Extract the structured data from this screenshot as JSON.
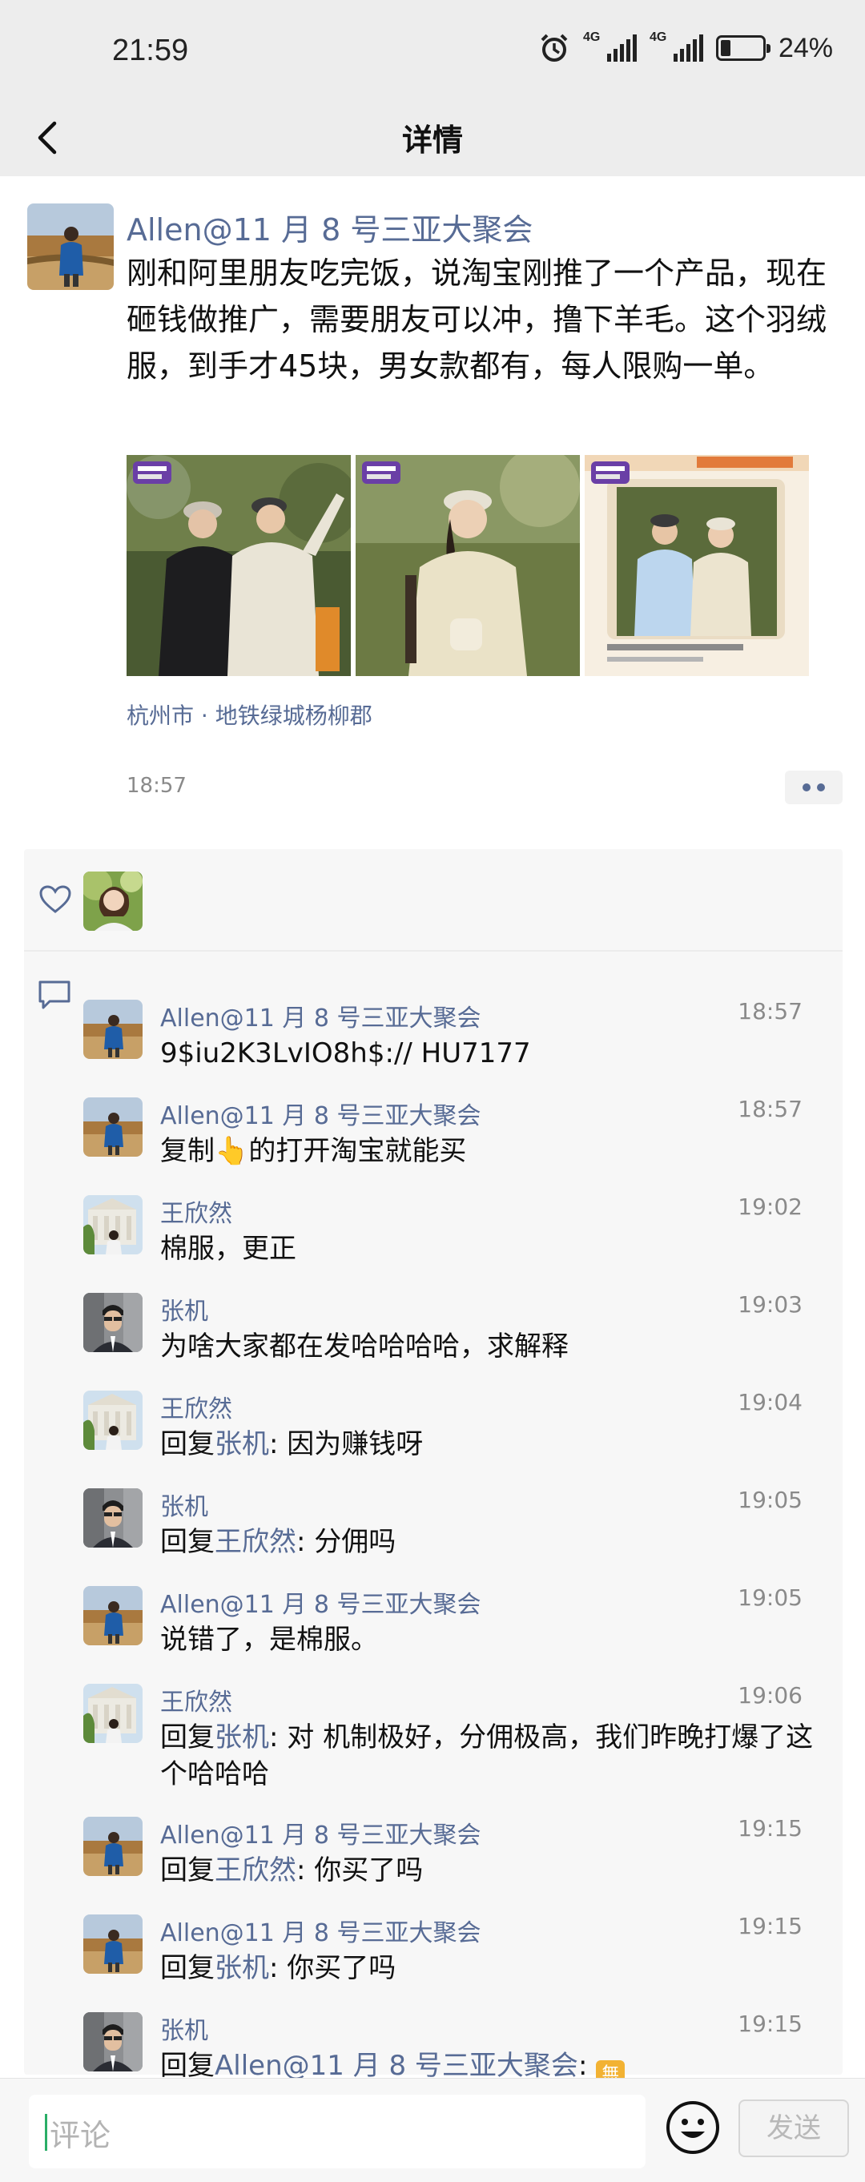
{
  "status_bar": {
    "time": "21:59",
    "net1": "4G",
    "net2": "4G",
    "battery": "24%",
    "battery_level": 0.24
  },
  "header": {
    "title": "详情",
    "back_icon": "chevron-left-icon"
  },
  "post": {
    "author": "Allen@11 月 8 号三亚大聚会",
    "text": "刚和阿里朋友吃完饭，说淘宝刚推了一个产品，现在砸钱做推广，需要朋友可以冲，撸下羊毛。这个羽绒服，到手才45块，男女款都有，每人限购一单。",
    "location": "杭州市 · 地铁绿城杨柳郡",
    "time": "18:57"
  },
  "colors": {
    "link": "#576b95",
    "accent_green": "#2aae67"
  },
  "comments": [
    {
      "author": "Allen@11 月 8 号三亚大聚会",
      "time": "18:57",
      "reply_prefix": "",
      "reply_to": "",
      "text": "9$iu2K3LvIO8h$:// HU7177",
      "avatar": "allen"
    },
    {
      "author": "Allen@11 月 8 号三亚大聚会",
      "time": "18:57",
      "reply_prefix": "",
      "reply_to": "",
      "text": "复制👆的打开淘宝就能买",
      "avatar": "allen"
    },
    {
      "author": "王欣然",
      "time": "19:02",
      "reply_prefix": "",
      "reply_to": "",
      "text": "棉服，更正",
      "avatar": "wang"
    },
    {
      "author": "张机",
      "time": "19:03",
      "reply_prefix": "",
      "reply_to": "",
      "text": "为啥大家都在发哈哈哈哈，求解释",
      "avatar": "zhang"
    },
    {
      "author": "王欣然",
      "time": "19:04",
      "reply_prefix": "回复",
      "reply_to": "张机",
      "text": ": 因为赚钱呀",
      "avatar": "wang"
    },
    {
      "author": "张机",
      "time": "19:05",
      "reply_prefix": "回复",
      "reply_to": "王欣然",
      "text": ": 分佣吗",
      "avatar": "zhang"
    },
    {
      "author": "Allen@11 月 8 号三亚大聚会",
      "time": "19:05",
      "reply_prefix": "",
      "reply_to": "",
      "text": "说错了，是棉服。",
      "avatar": "allen"
    },
    {
      "author": "王欣然",
      "time": "19:06",
      "reply_prefix": "回复",
      "reply_to": "张机",
      "text": ": 对 机制极好，分佣极高，我们昨晚打爆了这个哈哈哈",
      "avatar": "wang"
    },
    {
      "author": "Allen@11 月 8 号三亚大聚会",
      "time": "19:15",
      "reply_prefix": "回复",
      "reply_to": "王欣然",
      "text": ": 你买了吗",
      "avatar": "allen"
    },
    {
      "author": "Allen@11 月 8 号三亚大聚会",
      "time": "19:15",
      "reply_prefix": "回复",
      "reply_to": "张机",
      "text": ": 你买了吗",
      "avatar": "allen"
    },
    {
      "author": "张机",
      "time": "19:15",
      "reply_prefix": "回复",
      "reply_to": "Allen@11 月 8 号三亚大聚会",
      "text": ": ",
      "emoji": "無",
      "avatar": "zhang"
    }
  ],
  "input": {
    "placeholder": "评论",
    "send_label": "发送"
  }
}
